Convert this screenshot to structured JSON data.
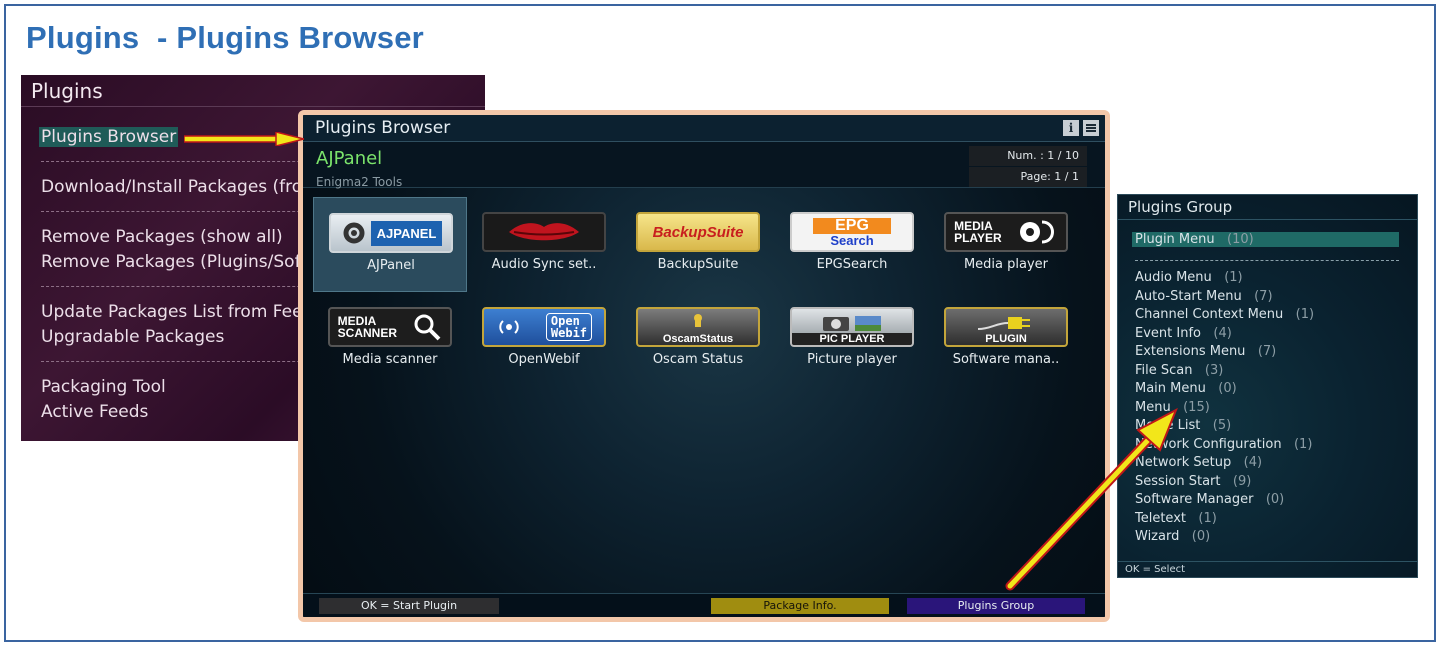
{
  "heading": "Plugins  - Plugins Browser",
  "plugins_menu": {
    "title": "Plugins",
    "items": [
      "Plugins Browser",
      "Download/Install Packages (fro",
      "Remove Packages (show all)",
      "Remove Packages (Plugins/Sof",
      "Update Packages List from Fee",
      "Upgradable Packages",
      "Packaging Tool",
      "Active Feeds"
    ]
  },
  "browser": {
    "title": "Plugins Browser",
    "info_icon": "i",
    "menu_icon": "menu-icon",
    "plugin_name": "AJPanel",
    "plugin_desc": "Enigma2 Tools",
    "num": "Num. : 1 / 10",
    "page": "Page: 1 / 1",
    "plugins": [
      {
        "label": "AJPanel",
        "logo": "AJPANEL"
      },
      {
        "label": "Audio Sync set..",
        "logo": ""
      },
      {
        "label": "BackupSuite",
        "logo": "BackupSuite"
      },
      {
        "label": "EPGSearch",
        "logo": "EPG",
        "logo_sub": "Search"
      },
      {
        "label": "Media player",
        "logo": "MEDIA",
        "logo_sub": "PLAYER"
      },
      {
        "label": "Media scanner",
        "logo": "MEDIA",
        "logo_sub": "SCANNER"
      },
      {
        "label": "OpenWebif",
        "logo": "Open",
        "logo_sub": "Webif"
      },
      {
        "label": "Oscam Status",
        "logo": "OscamStatus"
      },
      {
        "label": "Picture player",
        "logo": "PIC PLAYER"
      },
      {
        "label": "Software mana..",
        "logo": "PLUGIN"
      }
    ],
    "footer": {
      "ok": "OK = Start Plugin",
      "yellow": "Package Info.",
      "blue": "Plugins Group"
    }
  },
  "group": {
    "title": "Plugins Group",
    "items": [
      {
        "name": "Plugin Menu",
        "count": "(10)"
      },
      {
        "name": "Audio Menu",
        "count": "(1)"
      },
      {
        "name": "Auto-Start Menu",
        "count": "(7)"
      },
      {
        "name": "Channel Context Menu",
        "count": "(1)"
      },
      {
        "name": "Event Info",
        "count": "(4)"
      },
      {
        "name": "Extensions Menu",
        "count": "(7)"
      },
      {
        "name": "File Scan",
        "count": "(3)"
      },
      {
        "name": "Main Menu",
        "count": "(0)"
      },
      {
        "name": "Menu",
        "count": "(15)"
      },
      {
        "name": "Movie List",
        "count": "(5)"
      },
      {
        "name": "Network Configuration",
        "count": "(1)"
      },
      {
        "name": "Network Setup",
        "count": "(4)"
      },
      {
        "name": "Session Start",
        "count": "(9)"
      },
      {
        "name": "Software Manager",
        "count": "(0)"
      },
      {
        "name": "Teletext",
        "count": "(1)"
      },
      {
        "name": "Wizard",
        "count": "(0)"
      }
    ],
    "footer": "OK = Select"
  },
  "colors": {
    "heading": "#2f6fb5",
    "selection": "#1f5b58",
    "plugin_name": "#7be36b",
    "yellow_button": "#a08d10",
    "blue_button": "#2a157a",
    "arrow": "#f2e61a"
  }
}
